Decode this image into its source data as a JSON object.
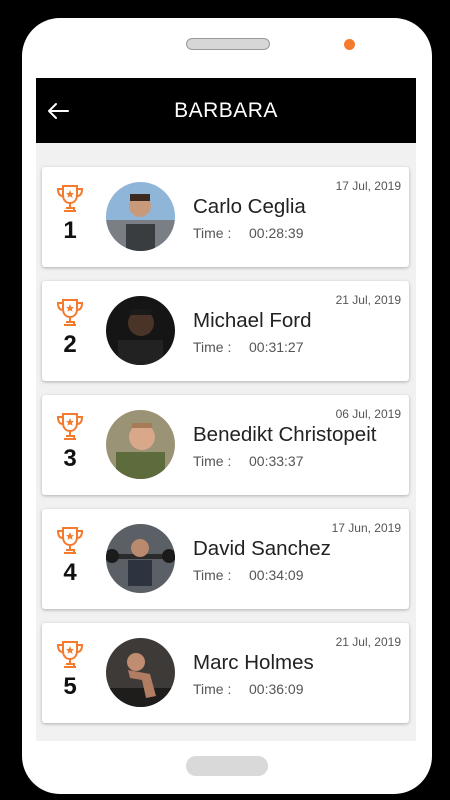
{
  "header": {
    "title": "BARBARA"
  },
  "time_label": "Time :",
  "colors": {
    "accent": "#f47a2d",
    "appbar": "#000000"
  },
  "entries": [
    {
      "rank": "1",
      "name": "Carlo Ceglia",
      "time": "00:28:39",
      "date": "17 Jul, 2019"
    },
    {
      "rank": "2",
      "name": "Michael Ford",
      "time": "00:31:27",
      "date": "21 Jul, 2019"
    },
    {
      "rank": "3",
      "name": "Benedikt Christopeit",
      "time": "00:33:37",
      "date": "06 Jul, 2019"
    },
    {
      "rank": "4",
      "name": "David Sanchez",
      "time": "00:34:09",
      "date": "17 Jun, 2019"
    },
    {
      "rank": "5",
      "name": "Marc Holmes",
      "time": "00:36:09",
      "date": "21 Jul, 2019"
    }
  ]
}
